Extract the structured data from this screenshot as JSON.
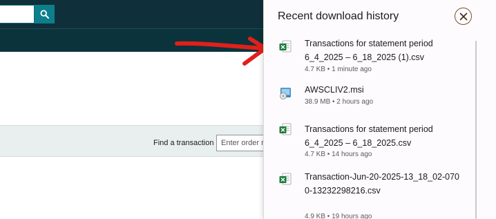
{
  "header": {
    "search_icon": "search-icon"
  },
  "filter": {
    "find_label": "Find a transaction",
    "find_placeholder": "Enter order r"
  },
  "downloads": {
    "title": "Recent download history",
    "close_icon": "close-circle-icon",
    "items": [
      {
        "icon": "excel-file-icon",
        "name": "Transactions for statement period 6_4_2025 – 6_18_2025 (1).csv",
        "meta": "4.7 KB • 1 minute ago"
      },
      {
        "icon": "msi-installer-icon",
        "name": "AWSCLIV2.msi",
        "meta": "38.9 MB • 2 hours ago"
      },
      {
        "icon": "excel-file-icon",
        "name": "Transactions for statement period 6_4_2025 – 6_18_2025.csv",
        "meta": "4.7 KB • 14 hours ago"
      },
      {
        "icon": "excel-file-icon",
        "name": "Transaction-Jun-20-2025-13_18_02-0700-13232298216.csv",
        "meta": "4.9 KB • 19 hours ago"
      }
    ]
  },
  "colors": {
    "header_bg": "#0f2f3a",
    "accent_teal": "#0d7f8c",
    "arrow_red": "#e0201b",
    "excel_green": "#1e7a3c"
  }
}
